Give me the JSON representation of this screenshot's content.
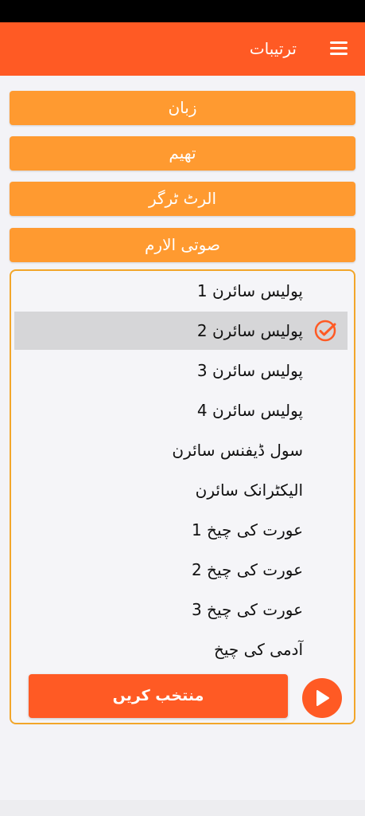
{
  "appbar": {
    "title": "ترتیبات"
  },
  "menu": {
    "language": "زبان",
    "theme": "تھیم",
    "alert_trigger": "الرٹ ٹرگر",
    "sound_alarm": "صوتی الارم"
  },
  "sounds": {
    "items": [
      "پولیس سائرن 1",
      "پولیس سائرن 2",
      "پولیس سائرن 3",
      "پولیس سائرن 4",
      "سول ڈیفنس سائرن",
      "الیکٹرانک سائرن",
      "عورت کی چیخ 1",
      "عورت کی چیخ 2",
      "عورت کی چیخ 3",
      "آدمی کی چیخ"
    ],
    "selected_index": 1
  },
  "actions": {
    "select_label": "منتخب کریں"
  },
  "colors": {
    "primary": "#ff5a24",
    "secondary": "#ff9a30",
    "border": "#f2a62a",
    "selected_row": "#d6d6d8"
  }
}
